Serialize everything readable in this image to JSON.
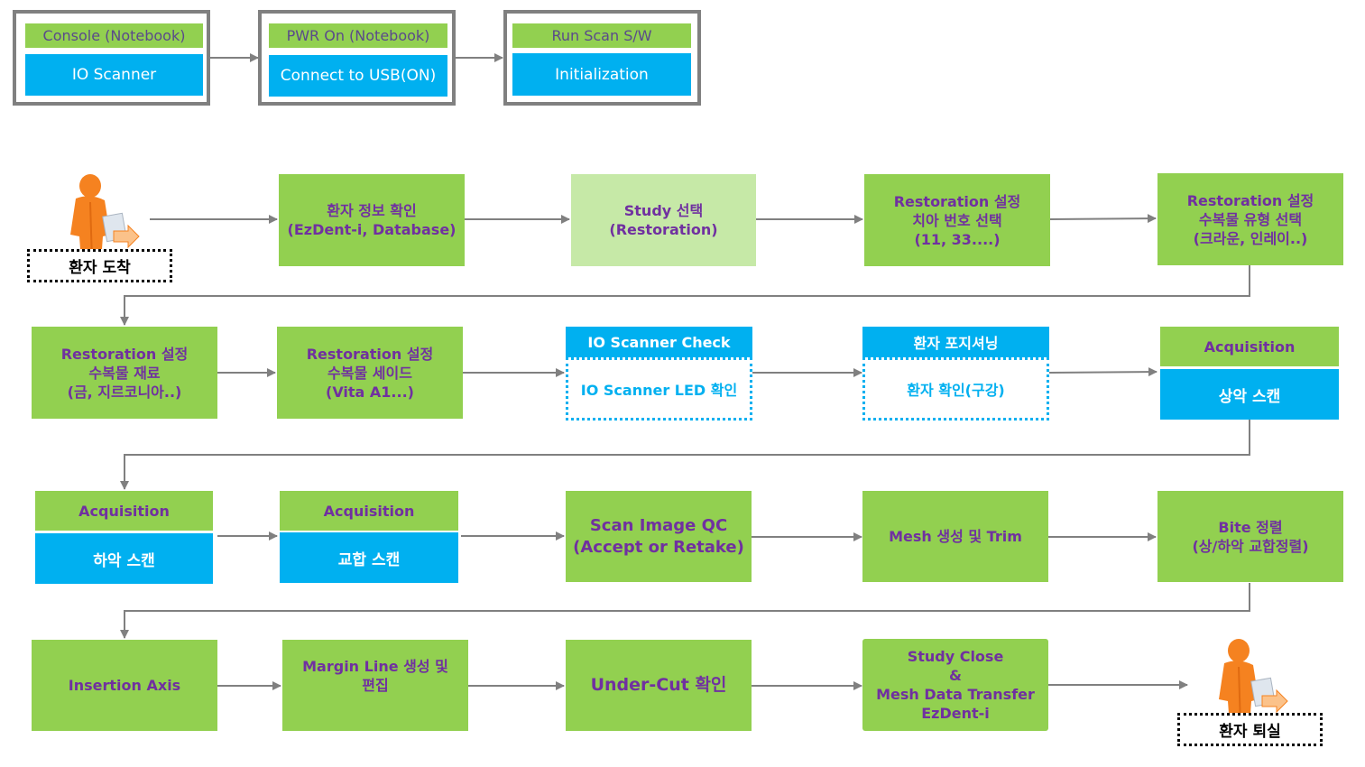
{
  "colors": {
    "green": "#92d050",
    "light_green": "#c6e9a7",
    "blue": "#00b0f0",
    "text_purple": "#7030a0",
    "connector_gray": "#808080",
    "person_orange": "#f58220"
  },
  "setup": [
    {
      "header": "Console (Notebook)",
      "body": "IO Scanner"
    },
    {
      "header": "PWR On (Notebook)",
      "body": "Connect to USB(ON)"
    },
    {
      "header": "Run Scan S/W",
      "body": "Initialization"
    }
  ],
  "start": {
    "icon": "person-icon",
    "label": "환자 도착"
  },
  "end": {
    "icon": "person-icon",
    "label": "환자 퇴실"
  },
  "row1": [
    {
      "lines": [
        "환자 정보 확인",
        "(EzDent-i, Database)"
      ]
    },
    {
      "lines": [
        "Study 선택",
        "(Restoration)"
      ]
    },
    {
      "lines": [
        "Restoration 설정",
        "치아 번호 선택",
        "(11, 33....)"
      ]
    },
    {
      "lines": [
        "Restoration 설정",
        "수복물 유형 선택",
        "(크라운, 인레이..)"
      ]
    }
  ],
  "row2": [
    {
      "lines": [
        "Restoration 설정",
        "수복물 재료",
        "(금, 지르코니아..)"
      ]
    },
    {
      "lines": [
        "Restoration 설정",
        "수복물 세이드",
        "(Vita A1...)"
      ]
    },
    {
      "header": "IO Scanner Check",
      "body": "IO Scanner LED 확인"
    },
    {
      "header": "환자 포지셔닝",
      "body": "환자 확인(구강)"
    },
    {
      "header": "Acquisition",
      "body": "상악 스캔"
    }
  ],
  "row3": [
    {
      "header": "Acquisition",
      "body": "하악 스캔"
    },
    {
      "header": "Acquisition",
      "body": "교합 스캔"
    },
    {
      "lines": [
        "Scan Image QC",
        "(Accept or Retake)"
      ]
    },
    {
      "lines": [
        "Mesh 생성 및 Trim"
      ]
    },
    {
      "lines": [
        "Bite 정렬",
        "(상/하악 교합정렬)"
      ]
    }
  ],
  "row4": [
    {
      "lines": [
        "Insertion Axis"
      ]
    },
    {
      "lines": [
        "Margin Line 생성 및",
        "편집"
      ]
    },
    {
      "lines": [
        "Under-Cut 확인"
      ]
    },
    {
      "lines": [
        "Study Close",
        "&",
        "Mesh Data Transfer",
        "EzDent-i"
      ]
    }
  ]
}
